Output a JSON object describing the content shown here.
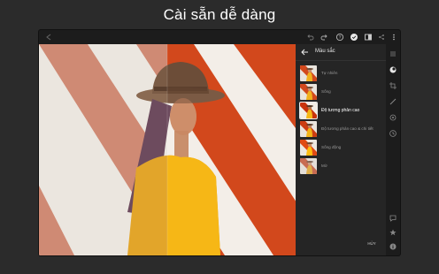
{
  "headline": "Cài sẵn dễ dàng",
  "colors": {
    "accent": "#1473e6",
    "background": "#2b2b2b",
    "panel": "#252525",
    "toolbar": "#1c1c1c"
  },
  "topbar": {
    "icons": [
      "back-icon",
      "undo-icon",
      "redo-icon",
      "help-icon",
      "cloud-sync-icon",
      "before-after-icon",
      "share-icon",
      "more-icon"
    ]
  },
  "panel": {
    "title": "Màu sắc",
    "presets": [
      {
        "label": "Tự nhiên"
      },
      {
        "label": "Sống"
      },
      {
        "label": "Độ tương phản cao"
      },
      {
        "label": "Độ tương phản cao & chi tiết"
      },
      {
        "label": "Sống động"
      },
      {
        "label": "Mờ"
      }
    ],
    "selected_index": 2,
    "cancel_label": "HỦY",
    "done_label": "HOÀN TẤT"
  },
  "rail": {
    "icons": [
      "presets-icon",
      "color-icon",
      "crop-icon",
      "brush-icon",
      "healing-icon",
      "history-icon",
      "comment-icon",
      "star-icon",
      "info-icon"
    ]
  }
}
